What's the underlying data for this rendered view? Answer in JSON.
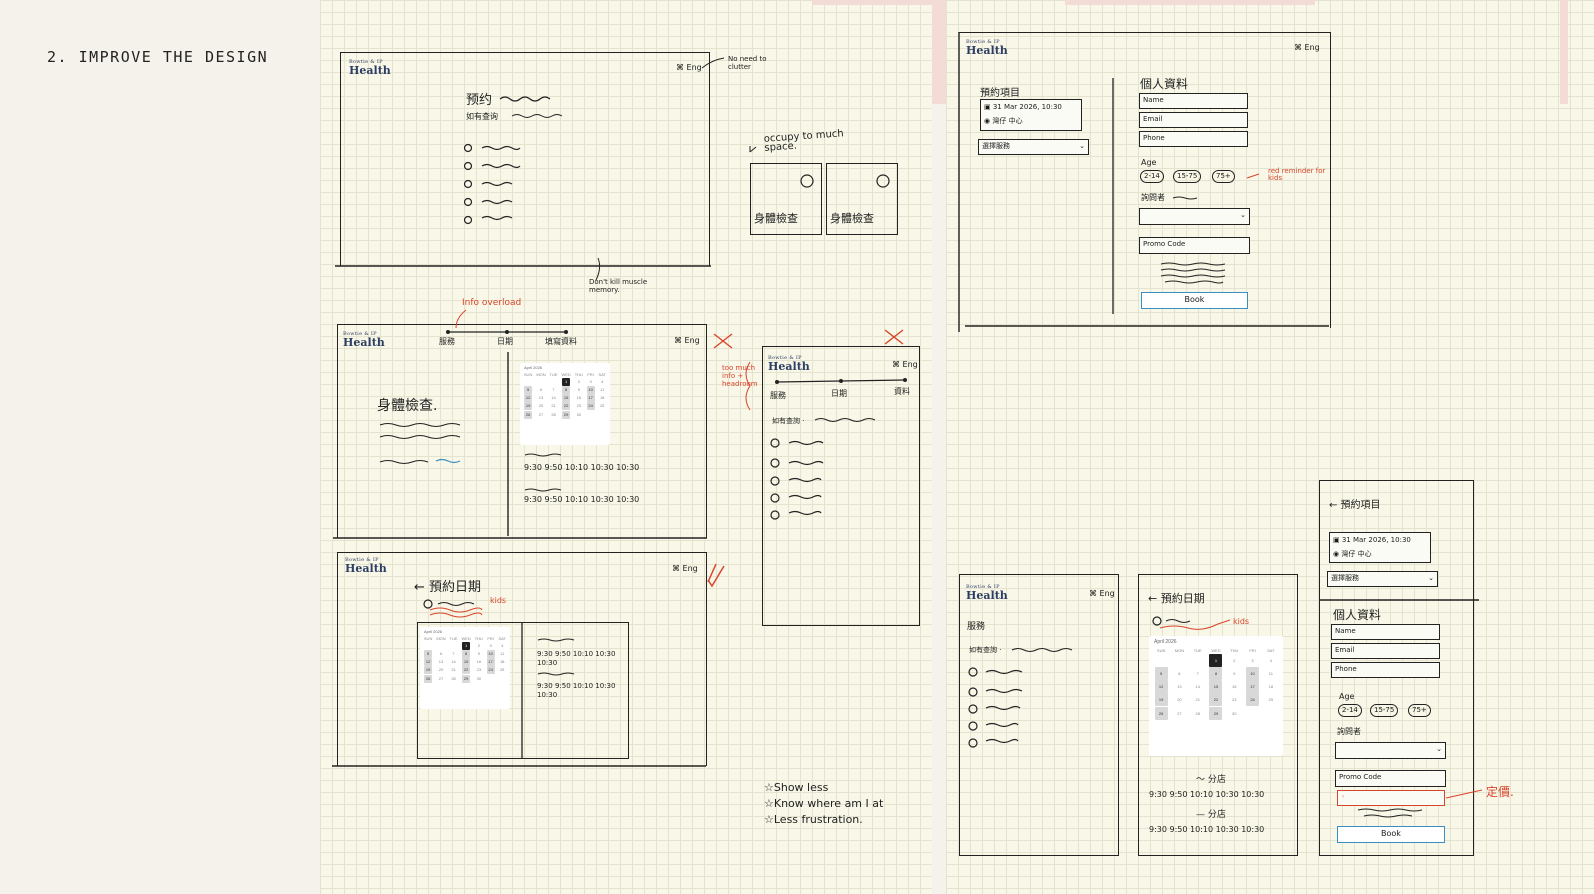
{
  "section_title": "2. IMPROVE THE DESIGN",
  "logo": {
    "small": "Bowtie & IP",
    "big": "Health"
  },
  "lang_label": "Eng",
  "sketch1": {
    "booking_title": "预约",
    "see_appointment": "如有查询",
    "note_no_clutter": "No need to clutter",
    "note_memory": "Don't kill muscle memory."
  },
  "side_cards": {
    "note_space": "occupy to much space.",
    "card_label": "身體檢查"
  },
  "sketch2": {
    "steps": [
      "服務",
      "日期",
      "填寫資料"
    ],
    "note_info": "Info overload",
    "service_name": "身體檢查.",
    "times": [
      "9:30",
      "9:50",
      "10:10",
      "10:30",
      "10:30"
    ],
    "note_left": "too much info + headroom"
  },
  "sketch3": {
    "back_title": "← 預約日期",
    "kids_note": "kids",
    "times_row1": "9:30  9:50  10:10  10:30 10:30",
    "times_row2": "9:30  9:50  10:10  10:30 10:30"
  },
  "sketch4": {
    "steps": [
      "服務",
      "日期",
      "資料"
    ],
    "query": "如有查詢 ·"
  },
  "takeaways": [
    "Show less",
    "Know where am I at",
    "Less frustration."
  ],
  "form_desktop": {
    "booking_items": "預約項目",
    "date_line": "31 Mar 2026, 10:30",
    "location_line": "灣仔 中心",
    "select_label": "選擇服務",
    "personal_info": "個人資料",
    "fields": [
      "Name",
      "Email",
      "Phone"
    ],
    "age_label": "Age",
    "age_options": [
      "2-14",
      "15-75",
      "75+"
    ],
    "red_note": "red reminder for kids",
    "question": "詢問者",
    "promo": "Promo Code",
    "book": "Book"
  },
  "mobile1": {
    "service": "服務",
    "query": "如有查詢 ·"
  },
  "mobile2": {
    "back_title": "← 預約日期",
    "kids_note": "kids",
    "section_a": "分店",
    "section_b": "分店",
    "times": "9:30  9:50  10:10  10:30 10:30"
  },
  "mobile3": {
    "back_title": "← 預約項目",
    "date_line": "31 Mar 2026, 10:30",
    "location_line": "灣仔 中心",
    "select_label": "選擇服務",
    "personal_info": "個人資料",
    "fields": [
      "Name",
      "Email",
      "Phone"
    ],
    "age_label": "Age",
    "age_options": [
      "2-14",
      "15-75",
      "75+"
    ],
    "question": "詢問者",
    "promo": "Promo Code",
    "error_note": "定價.",
    "book": "Book"
  },
  "calendar": {
    "month": "April 2026",
    "days": [
      "SUN",
      "MON",
      "TUE",
      "WED",
      "THU",
      "FRI",
      "SAT"
    ],
    "weeks": [
      [
        "",
        "",
        "",
        "1",
        "2",
        "3",
        "4"
      ],
      [
        "5",
        "6",
        "7",
        "8",
        "9",
        "10",
        "11"
      ],
      [
        "12",
        "13",
        "14",
        "15",
        "16",
        "17",
        "18"
      ],
      [
        "19",
        "20",
        "21",
        "22",
        "23",
        "24",
        "25"
      ],
      [
        "26",
        "27",
        "28",
        "29",
        "30",
        "",
        ""
      ]
    ]
  },
  "colors": {
    "accent_red": "#d9452b",
    "accent_blue": "#3a8fc2",
    "ink": "#222222"
  }
}
